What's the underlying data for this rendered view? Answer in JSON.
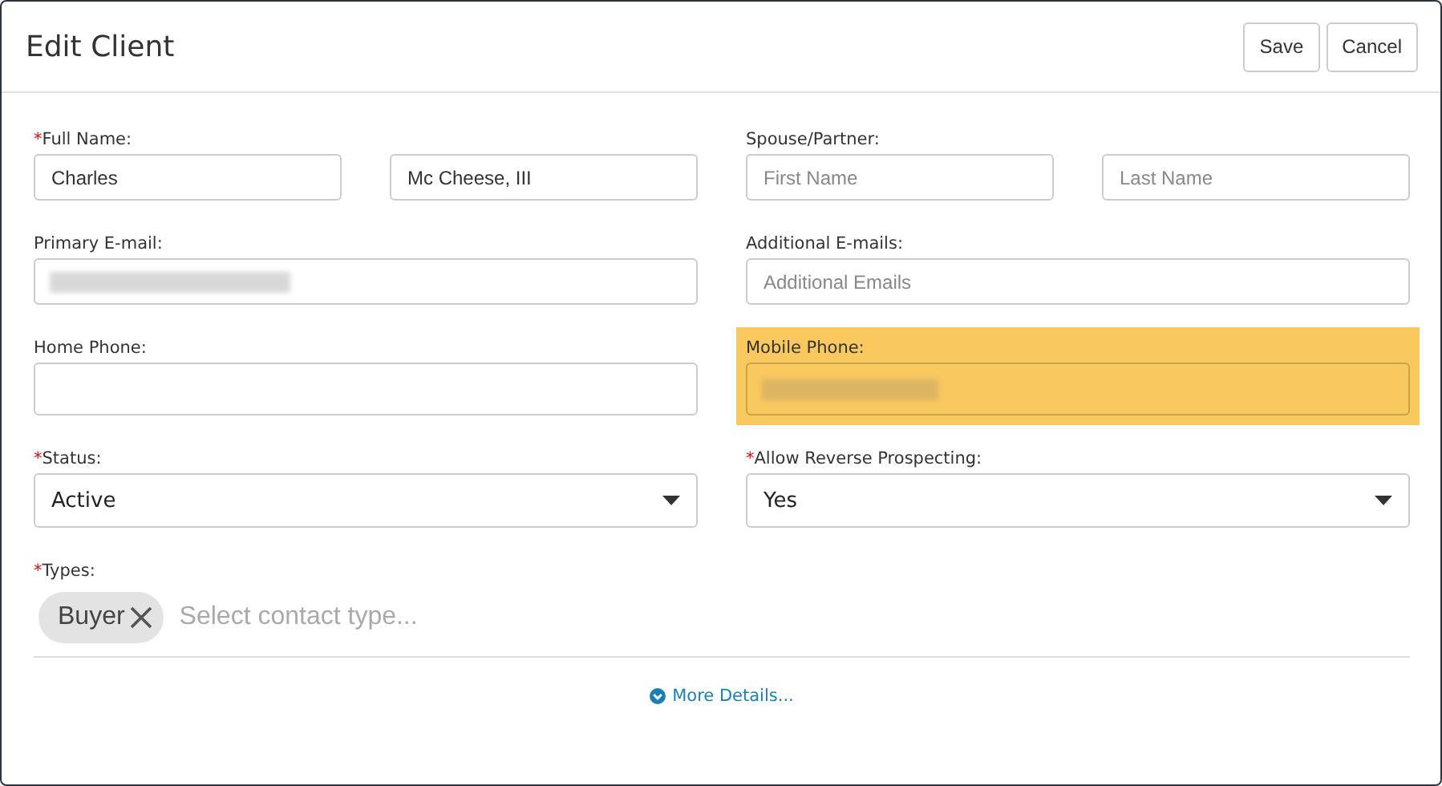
{
  "dialog": {
    "title": "Edit Client",
    "buttons": [
      {
        "label": "Save"
      },
      {
        "label": "Cancel"
      }
    ]
  },
  "rows": [
    {
      "fields": [
        {
          "kind": "pair",
          "label": "Full Name:",
          "required_mark": "*",
          "highlighted": false,
          "inputs": [
            {
              "value": "Charles"
            },
            {
              "value": "Mc Cheese, III"
            }
          ]
        },
        {
          "kind": "pair",
          "label": "Spouse/Partner:",
          "highlighted": false,
          "inputs": [
            {
              "placeholder": "First Name"
            },
            {
              "placeholder": "Last Name"
            }
          ]
        }
      ]
    },
    {
      "fields": [
        {
          "kind": "text",
          "label": "Primary E-mail:",
          "highlighted": false,
          "redacted": true
        },
        {
          "kind": "text",
          "label": "Additional E-mails:",
          "highlighted": false,
          "placeholder": "Additional Emails"
        }
      ]
    },
    {
      "fields": [
        {
          "kind": "text",
          "label": "Home Phone:",
          "highlighted": false
        },
        {
          "kind": "text",
          "label": "Mobile Phone:",
          "highlighted": true,
          "redacted": true
        }
      ]
    },
    {
      "fields": [
        {
          "kind": "select",
          "label": "Status:",
          "required_mark": "*",
          "highlighted": false,
          "value": "Active"
        },
        {
          "kind": "select",
          "label": "Allow Reverse Prospecting:",
          "required_mark": "*",
          "highlighted": false,
          "value": "Yes"
        }
      ]
    },
    {
      "fields": [
        {
          "kind": "tags",
          "label": "Types:",
          "required_mark": "*",
          "highlighted": false,
          "tags": [
            {
              "label": "Buyer"
            }
          ],
          "placeholder": "Select contact type..."
        }
      ]
    }
  ],
  "more_link": {
    "label": "More Details..."
  }
}
